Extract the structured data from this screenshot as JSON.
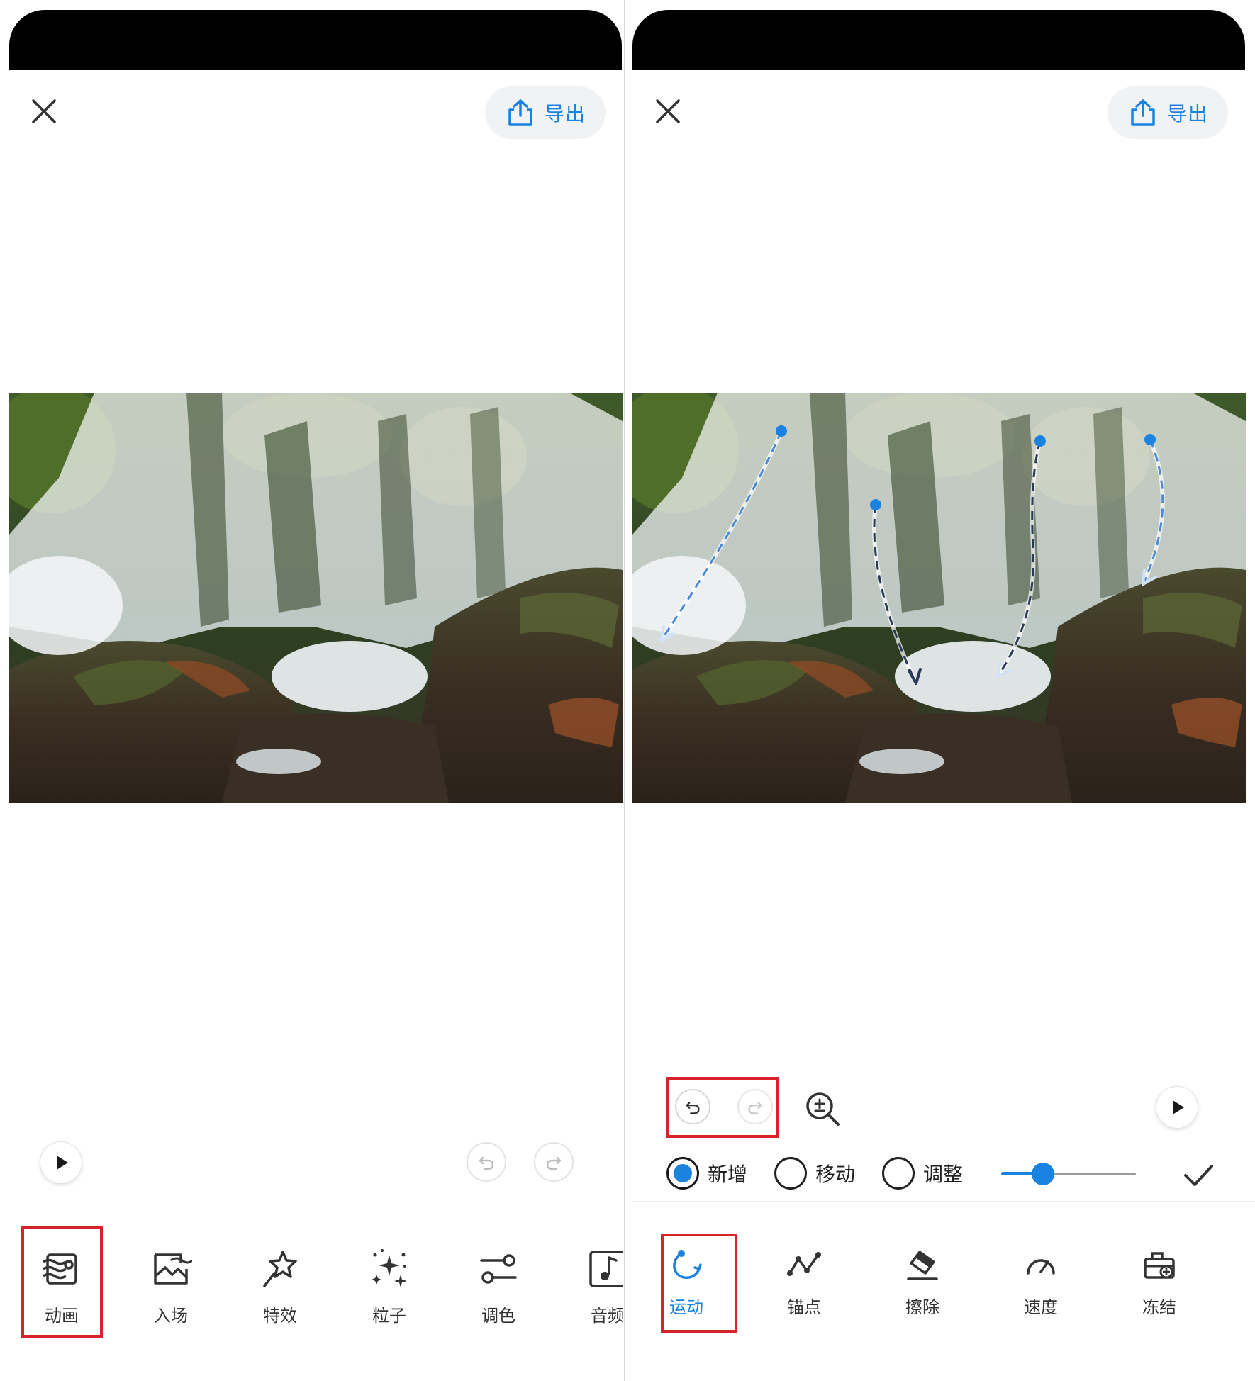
{
  "colors": {
    "accent": "#1a82e0",
    "highlight": "#d8232a",
    "statusbar": "#000000"
  },
  "left": {
    "close_icon": "close-icon",
    "export_label": "导出",
    "toolbar": [
      {
        "label": "动画",
        "icon": "animation-icon"
      },
      {
        "label": "入场",
        "icon": "entrance-icon"
      },
      {
        "label": "特效",
        "icon": "effects-icon"
      },
      {
        "label": "粒子",
        "icon": "particles-icon"
      },
      {
        "label": "调色",
        "icon": "color-adjust-icon"
      },
      {
        "label": "音频",
        "icon": "audio-icon"
      }
    ],
    "highlighted_tool": "动画"
  },
  "right": {
    "close_icon": "close-icon",
    "export_label": "导出",
    "modes": [
      {
        "label": "新增",
        "selected": true
      },
      {
        "label": "移动",
        "selected": false
      },
      {
        "label": "调整",
        "selected": false
      }
    ],
    "slider_value": 0.31,
    "toolbar": [
      {
        "label": "运动",
        "icon": "motion-icon",
        "active": true
      },
      {
        "label": "锚点",
        "icon": "anchor-icon",
        "active": false
      },
      {
        "label": "擦除",
        "icon": "eraser-icon",
        "active": false
      },
      {
        "label": "速度",
        "icon": "speed-icon",
        "active": false
      },
      {
        "label": "冻结",
        "icon": "freeze-icon",
        "active": false
      }
    ],
    "highlighted_tool": "运动"
  }
}
